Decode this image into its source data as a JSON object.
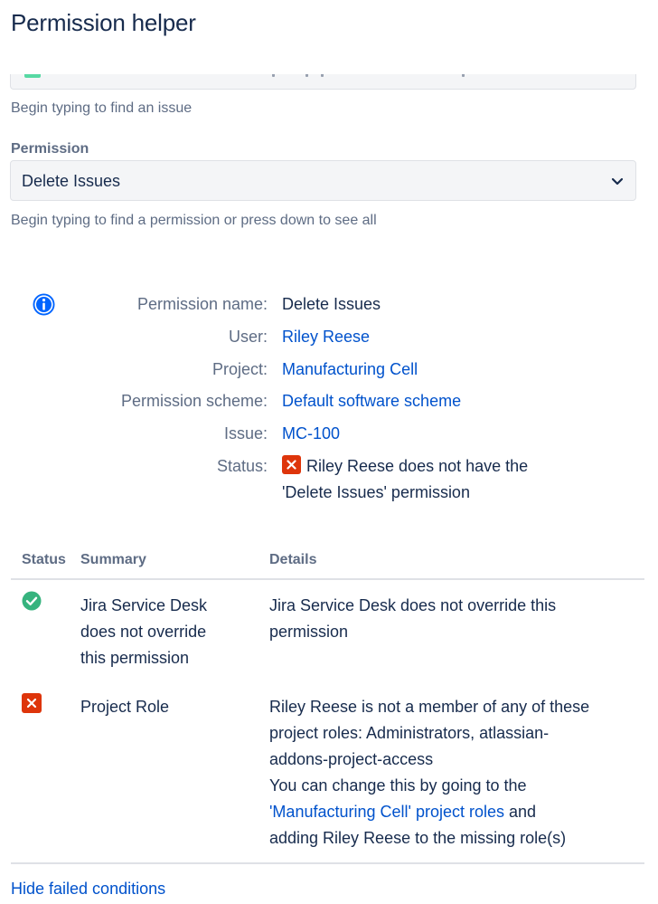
{
  "page": {
    "title": "Permission helper"
  },
  "issue_field": {
    "hint": "Begin typing to find an issue"
  },
  "permission_field": {
    "label": "Permission",
    "selected": "Delete Issues",
    "hint": "Begin typing to find a permission or press down to see all"
  },
  "details": {
    "permission_name_label": "Permission name:",
    "permission_name": "Delete Issues",
    "user_label": "User:",
    "user": "Riley Reese",
    "project_label": "Project:",
    "project": "Manufacturing Cell",
    "scheme_label": "Permission scheme:",
    "scheme": "Default software scheme",
    "issue_label": "Issue:",
    "issue": "MC-100",
    "status_label": "Status:",
    "status_line1": "Riley Reese does not have the",
    "status_line2": "'Delete Issues' permission"
  },
  "table": {
    "headers": {
      "status": "Status",
      "summary": "Summary",
      "details": "Details"
    },
    "rows": [
      {
        "status": "pass",
        "summary": [
          "Jira Service Desk",
          "does not override",
          "this permission"
        ],
        "details": [
          "Jira Service Desk does not override this",
          "permission"
        ]
      },
      {
        "status": "fail",
        "summary": [
          "Project Role"
        ],
        "details": [
          "Riley Reese is not a member of any of these",
          "project roles: Administrators, atlassian-",
          "addons-project-access"
        ],
        "help_line1": "You can change this by going to the",
        "help_link": "'Manufacturing Cell' project roles",
        "help_after_link": " and",
        "help_line3": "adding Riley Reese to the missing role(s)"
      }
    ]
  },
  "footer": {
    "hide_failed": "Hide failed conditions"
  },
  "colors": {
    "link": "#0052cc",
    "success": "#36b37e",
    "error": "#de350b",
    "info": "#0065ff"
  }
}
